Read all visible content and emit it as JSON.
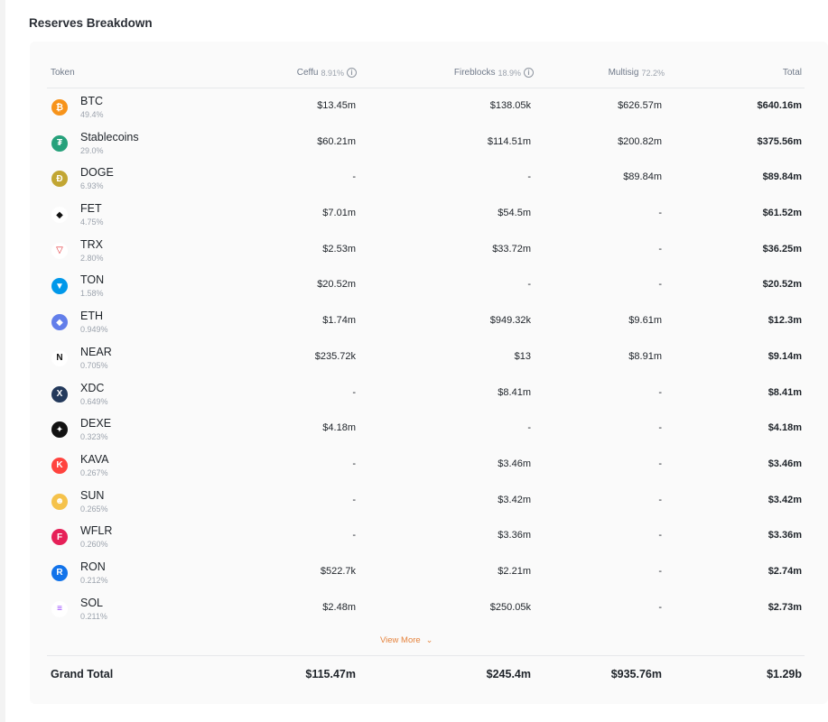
{
  "section_title": "Reserves Breakdown",
  "header": {
    "token": "Token",
    "ceffu": "Ceffu",
    "ceffu_pct": "8.91%",
    "fireblocks": "Fireblocks",
    "fireblocks_pct": "18.9%",
    "multisig": "Multisig",
    "multisig_pct": "72.2%",
    "total": "Total"
  },
  "rows": [
    {
      "name": "BTC",
      "pct": "49.4%",
      "ceffu": "$13.45m",
      "fireblocks": "$138.05k",
      "multisig": "$626.57m",
      "total": "$640.16m",
      "icon": "btc-icon",
      "color": "#f7931a",
      "glyph": "₿"
    },
    {
      "name": "Stablecoins",
      "pct": "29.0%",
      "ceffu": "$60.21m",
      "fireblocks": "$114.51m",
      "multisig": "$200.82m",
      "total": "$375.56m",
      "icon": "usdt-icon",
      "color": "#26a17b",
      "glyph": "₮"
    },
    {
      "name": "DOGE",
      "pct": "6.93%",
      "ceffu": "-",
      "fireblocks": "-",
      "multisig": "$89.84m",
      "total": "$89.84m",
      "icon": "doge-icon",
      "color": "#c2a633",
      "glyph": "Ð"
    },
    {
      "name": "FET",
      "pct": "4.75%",
      "ceffu": "$7.01m",
      "fireblocks": "$54.5m",
      "multisig": "-",
      "total": "$61.52m",
      "icon": "fet-icon",
      "color": "#ffffff",
      "glyph": "◆"
    },
    {
      "name": "TRX",
      "pct": "2.80%",
      "ceffu": "$2.53m",
      "fireblocks": "$33.72m",
      "multisig": "-",
      "total": "$36.25m",
      "icon": "trx-icon",
      "color": "#ffffff",
      "glyph": "▽"
    },
    {
      "name": "TON",
      "pct": "1.58%",
      "ceffu": "$20.52m",
      "fireblocks": "-",
      "multisig": "-",
      "total": "$20.52m",
      "icon": "ton-icon",
      "color": "#0098ea",
      "glyph": "▼"
    },
    {
      "name": "ETH",
      "pct": "0.949%",
      "ceffu": "$1.74m",
      "fireblocks": "$949.32k",
      "multisig": "$9.61m",
      "total": "$12.3m",
      "icon": "eth-icon",
      "color": "#627eea",
      "glyph": "◆"
    },
    {
      "name": "NEAR",
      "pct": "0.705%",
      "ceffu": "$235.72k",
      "fireblocks": "$13",
      "multisig": "$8.91m",
      "total": "$9.14m",
      "icon": "near-icon",
      "color": "#ffffff",
      "glyph": "N"
    },
    {
      "name": "XDC",
      "pct": "0.649%",
      "ceffu": "-",
      "fireblocks": "$8.41m",
      "multisig": "-",
      "total": "$8.41m",
      "icon": "xdc-icon",
      "color": "#23395b",
      "glyph": "X"
    },
    {
      "name": "DEXE",
      "pct": "0.323%",
      "ceffu": "$4.18m",
      "fireblocks": "-",
      "multisig": "-",
      "total": "$4.18m",
      "icon": "dexe-icon",
      "color": "#111111",
      "glyph": "✦"
    },
    {
      "name": "KAVA",
      "pct": "0.267%",
      "ceffu": "-",
      "fireblocks": "$3.46m",
      "multisig": "-",
      "total": "$3.46m",
      "icon": "kava-icon",
      "color": "#ff433e",
      "glyph": "K"
    },
    {
      "name": "SUN",
      "pct": "0.265%",
      "ceffu": "-",
      "fireblocks": "$3.42m",
      "multisig": "-",
      "total": "$3.42m",
      "icon": "sun-icon",
      "color": "#f5c24b",
      "glyph": "☻"
    },
    {
      "name": "WFLR",
      "pct": "0.260%",
      "ceffu": "-",
      "fireblocks": "$3.36m",
      "multisig": "-",
      "total": "$3.36m",
      "icon": "wflr-icon",
      "color": "#e62058",
      "glyph": "F"
    },
    {
      "name": "RON",
      "pct": "0.212%",
      "ceffu": "$522.7k",
      "fireblocks": "$2.21m",
      "multisig": "-",
      "total": "$2.74m",
      "icon": "ron-icon",
      "color": "#1273ea",
      "glyph": "R"
    },
    {
      "name": "SOL",
      "pct": "0.211%",
      "ceffu": "$2.48m",
      "fireblocks": "$250.05k",
      "multisig": "-",
      "total": "$2.73m",
      "icon": "sol-icon",
      "color": "#ffffff",
      "glyph": "≡"
    }
  ],
  "view_more": "View More",
  "grand_total": {
    "label": "Grand Total",
    "ceffu": "$115.47m",
    "fireblocks": "$245.4m",
    "multisig": "$935.76m",
    "total": "$1.29b"
  }
}
